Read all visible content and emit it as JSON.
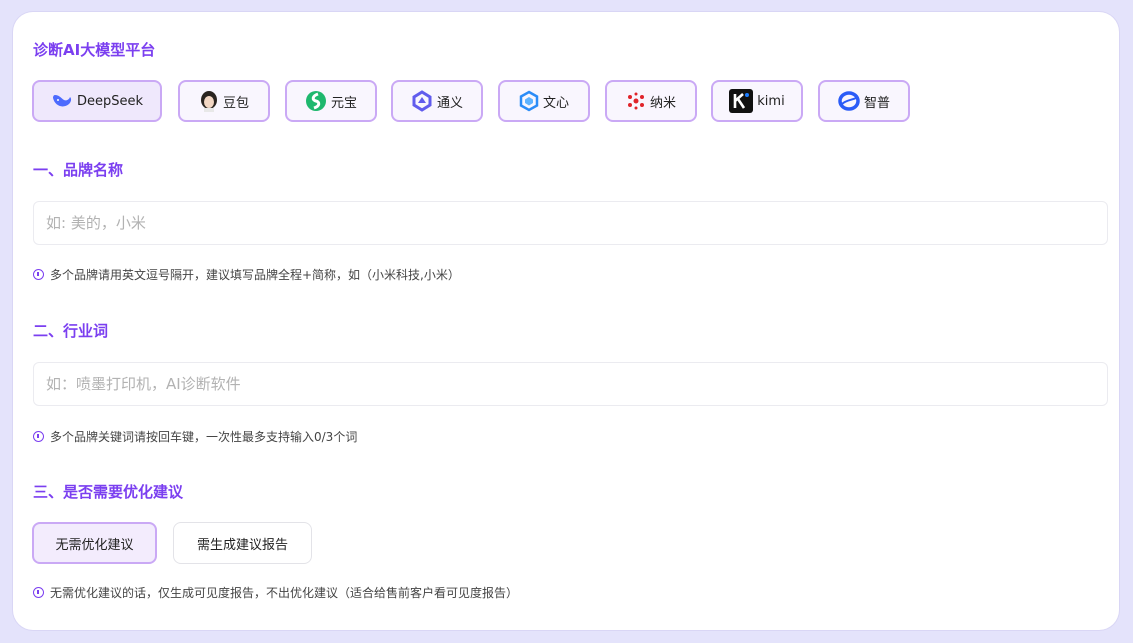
{
  "title": "诊断AI大模型平台",
  "platforms": [
    {
      "label": "DeepSeek",
      "icon": "deepseek-whale-icon"
    },
    {
      "label": "豆包",
      "icon": "doubao-avatar-icon"
    },
    {
      "label": "元宝",
      "icon": "yuanbao-icon"
    },
    {
      "label": "通义",
      "icon": "tongyi-icon"
    },
    {
      "label": "文心",
      "icon": "wenxin-icon"
    },
    {
      "label": "纳米",
      "icon": "nami-icon"
    },
    {
      "label": "kimi",
      "icon": "kimi-icon"
    },
    {
      "label": "智普",
      "icon": "zhipu-icon"
    }
  ],
  "section1": {
    "heading": "一、品牌名称",
    "placeholder": "如: 美的，小米",
    "hint": "多个品牌请用英文逗号隔开，建议填写品牌全程+简称，如（小米科技,小米）"
  },
  "section2": {
    "heading": "二、行业词",
    "placeholder": "如：喷墨打印机，AI诊断软件",
    "hint": "多个品牌关键词请按回车键，一次性最多支持输入0/3个词"
  },
  "section3": {
    "heading": "三、是否需要优化建议",
    "options": [
      "无需优化建议",
      "需生成建议报告"
    ],
    "selected_index": 0,
    "hint": "无需优化建议的话，仅生成可见度报告，不出优化建议（适合给售前客户看可见度报告）"
  },
  "colors": {
    "accent": "#7b3ff0",
    "border": "#caa9f5",
    "background": "#e4e3fb"
  }
}
